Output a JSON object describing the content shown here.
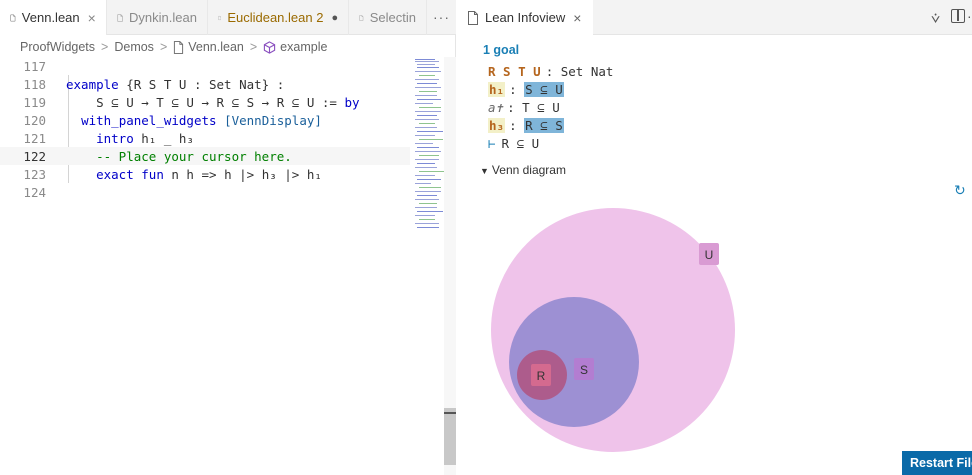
{
  "editor": {
    "tabs": [
      {
        "label": "Venn.lean",
        "active": true,
        "close": "×"
      },
      {
        "label": "Dynkin.lean",
        "active": false
      },
      {
        "label": "Euclidean.lean 2",
        "active": false,
        "modified": true,
        "dot": "●"
      },
      {
        "label": "Selectin",
        "active": false
      }
    ],
    "tabs_more": "···",
    "breadcrumb": {
      "items": [
        "ProofWidgets",
        "Demos",
        "Venn.lean",
        "example"
      ],
      "separator": ">"
    },
    "lines": [
      {
        "no": "117",
        "text": ""
      },
      {
        "no": "118",
        "text": "example {R S T U : Set Nat} :"
      },
      {
        "no": "119",
        "text": "    S ⊆ U → T ⊆ U → R ⊆ S → R ⊆ U := by"
      },
      {
        "no": "120",
        "text": "  with_panel_widgets [VennDisplay]"
      },
      {
        "no": "121",
        "text": "    intro h₁ _ h₃"
      },
      {
        "no": "122",
        "text": "    -- Place your cursor here."
      },
      {
        "no": "123",
        "text": "    exact fun n h => h |> h₃ |> h₁"
      },
      {
        "no": "124",
        "text": ""
      }
    ]
  },
  "infoview": {
    "tab_label": "Lean Infoview",
    "tab_close": "×",
    "merge_icon": "⩒",
    "more_icon": "···",
    "goal_count": "1 goal",
    "hyps": [
      {
        "name": "R S T U",
        "type": ": Set Nat"
      },
      {
        "name": "h₁",
        "type_prefix": ": ",
        "type": "S ⊆ U"
      },
      {
        "name": "a✝",
        "type": ": T ⊆ U"
      },
      {
        "name": "h₃",
        "type_prefix": ": ",
        "type": "R ⊆ S"
      }
    ],
    "goal": {
      "turnstile": "⊢",
      "target": "R ⊆ U"
    },
    "venn_summary": "Venn diagram",
    "venn_labels": {
      "U": "U",
      "S": "S",
      "R": "R"
    },
    "restart_button": "Restart File",
    "colors": {
      "u_fill": "#efc3ea",
      "s_fill": "#8e87cf",
      "r_fill": "#b0537f",
      "accent": "#0a6aa8"
    }
  }
}
